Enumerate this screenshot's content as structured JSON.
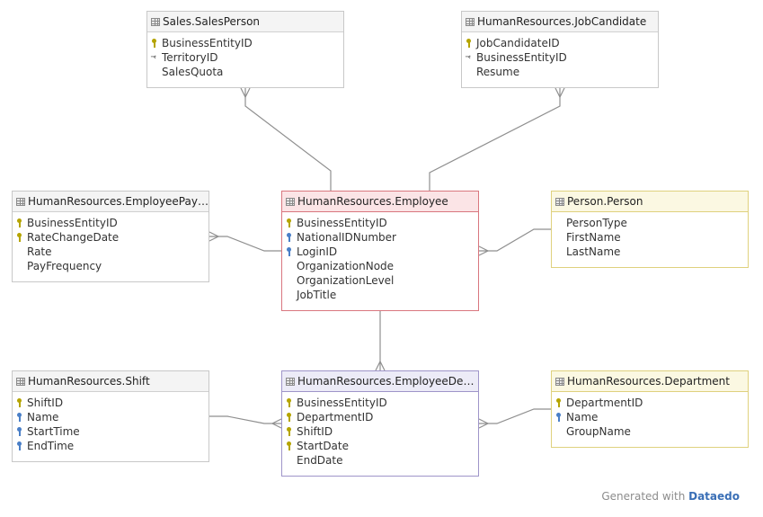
{
  "tables": {
    "salesperson": {
      "title": "Sales.SalesPerson",
      "columns": [
        {
          "name": "BusinessEntityID",
          "icon": "primary-key"
        },
        {
          "name": "TerritoryID",
          "icon": "foreign-key"
        },
        {
          "name": "SalesQuota",
          "icon": "none"
        }
      ]
    },
    "jobcandidate": {
      "title": "HumanResources.JobCandidate",
      "columns": [
        {
          "name": "JobCandidateID",
          "icon": "primary-key"
        },
        {
          "name": "BusinessEntityID",
          "icon": "foreign-key"
        },
        {
          "name": "Resume",
          "icon": "none"
        }
      ]
    },
    "payhistory": {
      "title": "HumanResources.EmployeePayHi...",
      "columns": [
        {
          "name": "BusinessEntityID",
          "icon": "primary-key"
        },
        {
          "name": "RateChangeDate",
          "icon": "primary-key"
        },
        {
          "name": "Rate",
          "icon": "none"
        },
        {
          "name": "PayFrequency",
          "icon": "none"
        }
      ]
    },
    "employee": {
      "title": "HumanResources.Employee",
      "columns": [
        {
          "name": "BusinessEntityID",
          "icon": "primary-key"
        },
        {
          "name": "NationalIDNumber",
          "icon": "unique-key"
        },
        {
          "name": "LoginID",
          "icon": "unique-key"
        },
        {
          "name": "OrganizationNode",
          "icon": "none"
        },
        {
          "name": "OrganizationLevel",
          "icon": "none"
        },
        {
          "name": "JobTitle",
          "icon": "none"
        }
      ]
    },
    "person": {
      "title": "Person.Person",
      "columns": [
        {
          "name": "PersonType",
          "icon": "none"
        },
        {
          "name": "FirstName",
          "icon": "none"
        },
        {
          "name": "LastName",
          "icon": "none"
        }
      ]
    },
    "shift": {
      "title": "HumanResources.Shift",
      "columns": [
        {
          "name": "ShiftID",
          "icon": "primary-key"
        },
        {
          "name": "Name",
          "icon": "unique-key"
        },
        {
          "name": "StartTime",
          "icon": "unique-key"
        },
        {
          "name": "EndTime",
          "icon": "unique-key"
        }
      ]
    },
    "deptHistory": {
      "title": "HumanResources.EmployeeDepar...",
      "columns": [
        {
          "name": "BusinessEntityID",
          "icon": "primary-key"
        },
        {
          "name": "DepartmentID",
          "icon": "primary-key"
        },
        {
          "name": "ShiftID",
          "icon": "primary-key"
        },
        {
          "name": "StartDate",
          "icon": "primary-key"
        },
        {
          "name": "EndDate",
          "icon": "none"
        }
      ]
    },
    "department": {
      "title": "HumanResources.Department",
      "columns": [
        {
          "name": "DepartmentID",
          "icon": "primary-key"
        },
        {
          "name": "Name",
          "icon": "unique-key"
        },
        {
          "name": "GroupName",
          "icon": "none"
        }
      ]
    }
  },
  "footer": {
    "prefix": "Generated with",
    "brand": "Dataedo"
  },
  "colors": {
    "main_table": "#d9777f",
    "link_table": "#9f95c9",
    "external_table": "#dfd17e",
    "primary_key": "#b5a400",
    "unique_key": "#4a7fc7",
    "brand": "#3a6fb6"
  }
}
